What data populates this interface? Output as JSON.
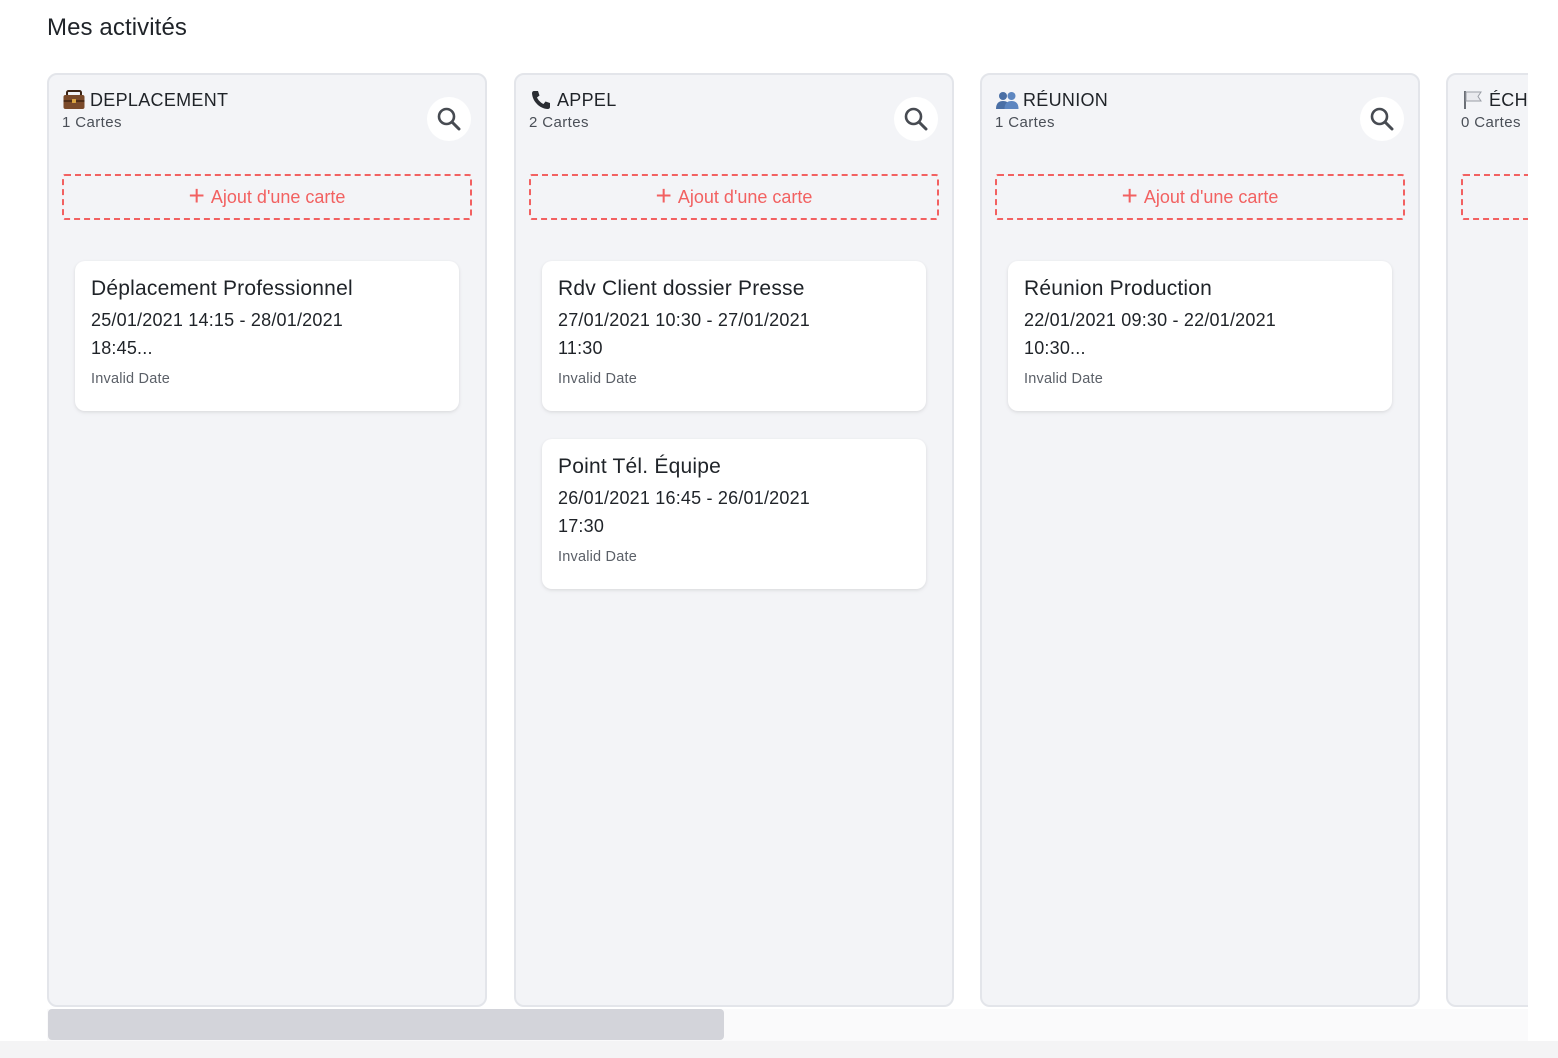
{
  "page": {
    "title": "Mes activités"
  },
  "add_card_label": "Ajout d'une carte",
  "colors": {
    "accent": "#f26161",
    "column_bg": "#f3f4f7",
    "card_bg": "#ffffff"
  },
  "columns": [
    {
      "title": "DEPLACEMENT",
      "icon": "briefcase-icon",
      "count": "1 Cartes",
      "cards": [
        {
          "title": "Déplacement Professionnel",
          "dates": "25/01/2021 14:15 - 28/01/2021 18:45...",
          "meta": "Invalid Date"
        }
      ]
    },
    {
      "title": "APPEL",
      "icon": "phone-icon",
      "count": "2 Cartes",
      "cards": [
        {
          "title": "Rdv Client dossier Presse",
          "dates": "27/01/2021 10:30 - 27/01/2021 11:30",
          "meta": "Invalid Date"
        },
        {
          "title": "Point Tél. Équipe",
          "dates": "26/01/2021 16:45 - 26/01/2021 17:30",
          "meta": "Invalid Date"
        }
      ]
    },
    {
      "title": "RÉUNION",
      "icon": "people-icon",
      "count": "1 Cartes",
      "cards": [
        {
          "title": "Réunion Production",
          "dates": "22/01/2021 09:30 - 22/01/2021 10:30...",
          "meta": "Invalid Date"
        }
      ]
    },
    {
      "title": "ÉCHÉANCE",
      "icon": "flag-icon",
      "count": "0 Cartes",
      "cards": []
    }
  ]
}
